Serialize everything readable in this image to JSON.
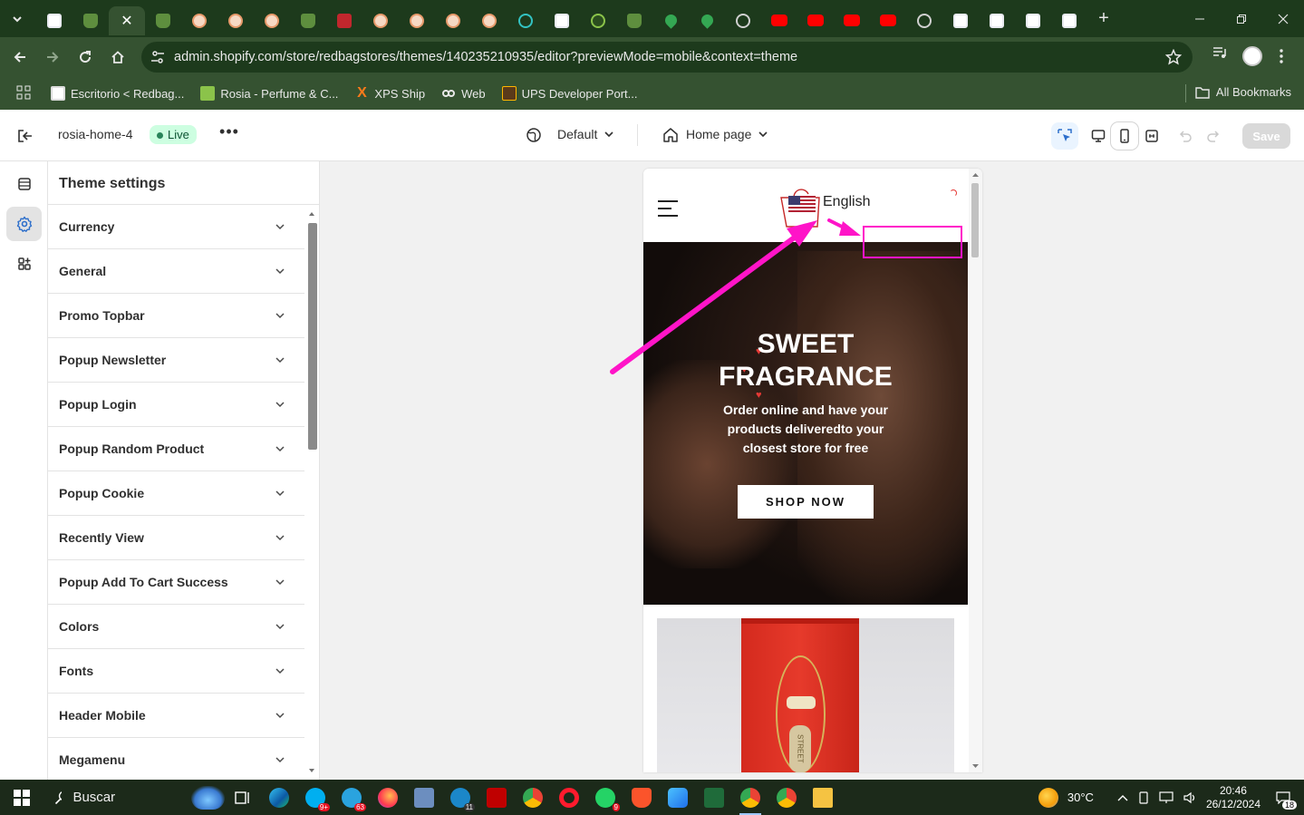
{
  "browser": {
    "active_tab_close": "✕",
    "new_tab": "+",
    "url": "admin.shopify.com/store/redbagstores/themes/140235210935/editor?previewMode=mobile&context=theme",
    "bookmarks": [
      {
        "label": "Escritorio < Redbag..."
      },
      {
        "label": "Rosia - Perfume & C..."
      },
      {
        "label": "XPS Ship"
      },
      {
        "label": "Web"
      },
      {
        "label": "UPS Developer Port..."
      }
    ],
    "all_bookmarks": "All Bookmarks"
  },
  "editor": {
    "theme_name": "rosia-home-4",
    "live_badge": "Live",
    "more": "•••",
    "language_select": "Default",
    "page_select": "Home page",
    "save": "Save"
  },
  "panel": {
    "title": "Theme settings",
    "items": [
      {
        "label": "Currency"
      },
      {
        "label": "General"
      },
      {
        "label": "Promo Topbar"
      },
      {
        "label": "Popup Newsletter"
      },
      {
        "label": "Popup Login"
      },
      {
        "label": "Popup Random Product"
      },
      {
        "label": "Popup Cookie"
      },
      {
        "label": "Recently View"
      },
      {
        "label": "Popup Add To Cart Success"
      },
      {
        "label": "Colors"
      },
      {
        "label": "Fonts"
      },
      {
        "label": "Header Mobile"
      },
      {
        "label": "Megamenu"
      }
    ]
  },
  "preview": {
    "language": "English",
    "hero_title_1": "SWEET",
    "hero_title_2": "FRAGRANCE",
    "hero_subtitle": "Order online and have your products deliveredto your closest store for free",
    "shop_button": "SHOP NOW",
    "product_box_text": "STREET"
  },
  "taskbar": {
    "search": "Buscar",
    "weather": "30°C",
    "time": "20:46",
    "date": "26/12/2024",
    "notification_count": "18",
    "badges": {
      "skype": "9+",
      "telegram": "63",
      "edge_c": "11",
      "whatsapp": "9"
    }
  },
  "colors": {
    "browser_frame": "#1d3a1c",
    "browser_toolbar": "#355231",
    "annotation": "#ff14c8",
    "live_badge_bg": "#cdfee1"
  }
}
